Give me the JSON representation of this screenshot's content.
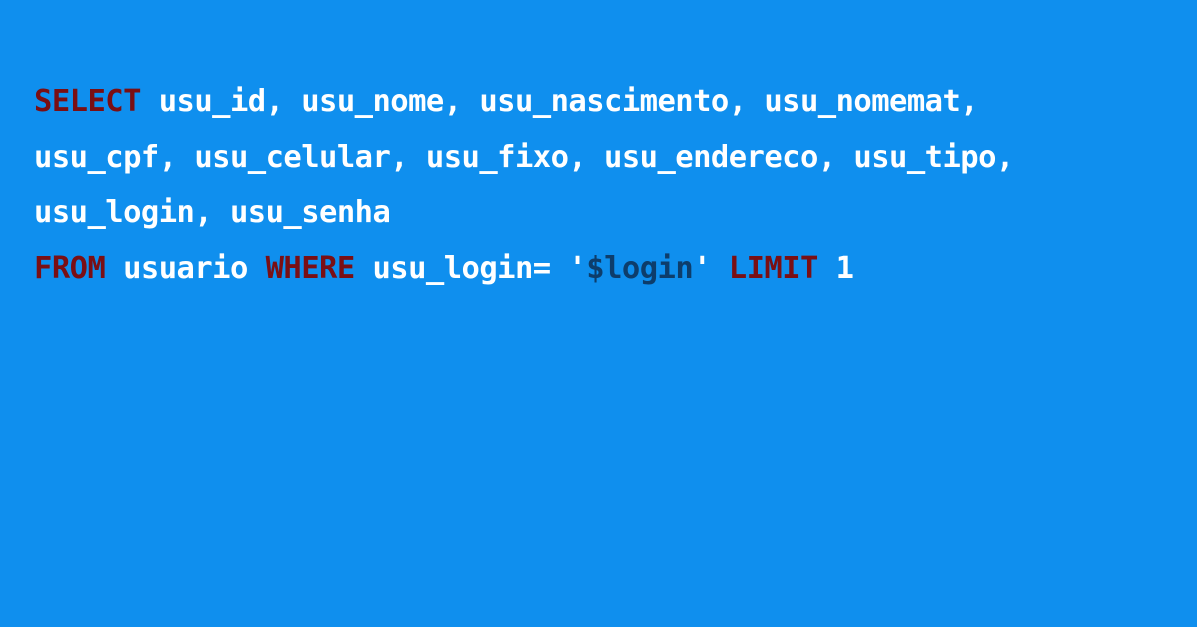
{
  "code": {
    "lines": [
      {
        "tokens": [
          {
            "type": "keyword",
            "text": "SELECT"
          },
          {
            "type": "plain",
            "text": " usu_id, usu_nome, usu_nascimento, usu_nomemat,"
          }
        ]
      },
      {
        "tokens": [
          {
            "type": "plain",
            "text": "usu_cpf, usu_celular, usu_fixo, usu_endereco, usu_tipo,"
          }
        ]
      },
      {
        "tokens": [
          {
            "type": "plain",
            "text": "usu_login, usu_senha"
          }
        ]
      },
      {
        "tokens": [
          {
            "type": "keyword",
            "text": "FROM"
          },
          {
            "type": "plain",
            "text": " usuario "
          },
          {
            "type": "keyword",
            "text": "WHERE"
          },
          {
            "type": "plain",
            "text": " usu_login= '"
          },
          {
            "type": "var",
            "text": "$login"
          },
          {
            "type": "plain",
            "text": "' "
          },
          {
            "type": "keyword",
            "text": "LIMIT"
          },
          {
            "type": "plain",
            "text": " 1"
          }
        ]
      }
    ]
  },
  "colors": {
    "background": "#0f8fee",
    "keyword": "#7a0f14",
    "plain": "#ffffff",
    "variable": "#0d3d6b"
  }
}
